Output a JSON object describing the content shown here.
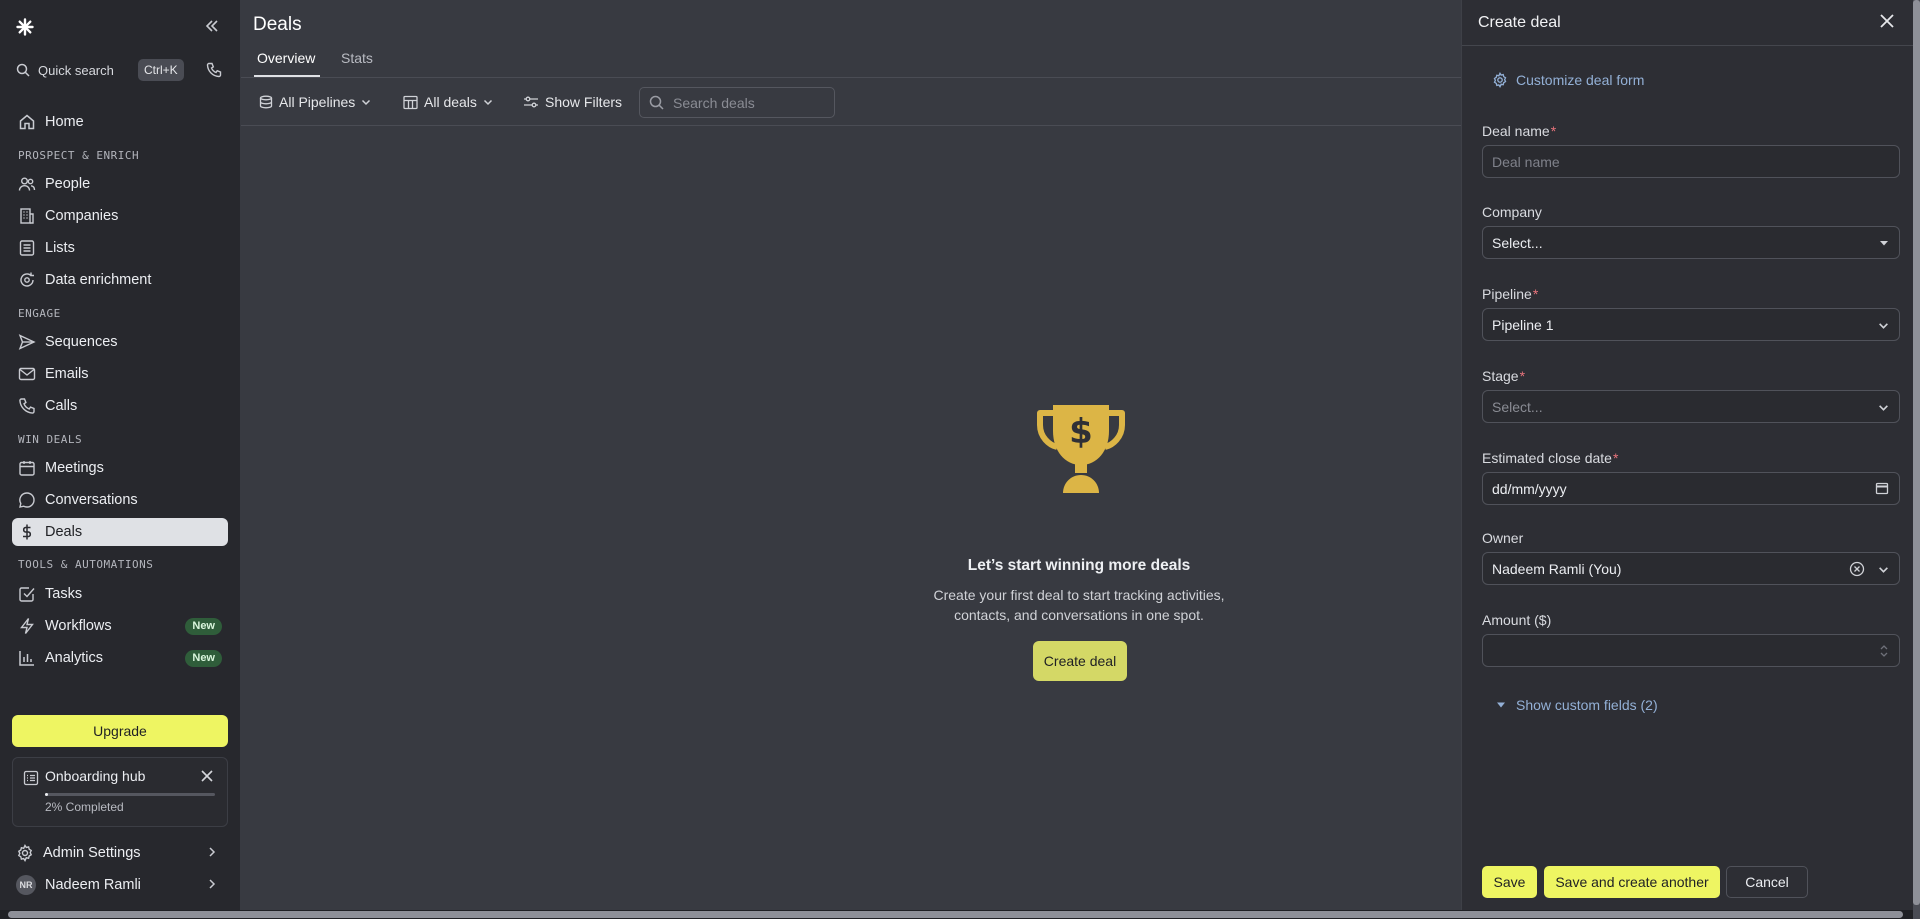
{
  "sidebar": {
    "quick_search": "Quick search",
    "shortcut": "Ctrl+K",
    "home": "Home",
    "sections": [
      "PROSPECT & ENRICH",
      "ENGAGE",
      "WIN DEALS",
      "TOOLS & AUTOMATIONS"
    ],
    "items": [
      {
        "label": "People",
        "icon": "people-icon"
      },
      {
        "label": "Companies",
        "icon": "building-icon"
      },
      {
        "label": "Lists",
        "icon": "list-icon"
      },
      {
        "label": "Data enrichment",
        "icon": "enrich-icon"
      },
      {
        "label": "Sequences",
        "icon": "send-icon"
      },
      {
        "label": "Emails",
        "icon": "mail-icon"
      },
      {
        "label": "Calls",
        "icon": "phone-icon"
      },
      {
        "label": "Meetings",
        "icon": "calendar-icon"
      },
      {
        "label": "Conversations",
        "icon": "chat-icon"
      },
      {
        "label": "Deals",
        "icon": "dollar-icon",
        "active": true
      },
      {
        "label": "Tasks",
        "icon": "check-icon"
      },
      {
        "label": "Workflows",
        "icon": "bolt-icon",
        "badge": "New"
      },
      {
        "label": "Analytics",
        "icon": "chart-icon",
        "badge": "New"
      }
    ],
    "upgrade": "Upgrade",
    "onboarding": {
      "title": "Onboarding hub",
      "progress_text": "2% Completed",
      "progress": 0.02
    },
    "admin_settings": "Admin Settings",
    "user": {
      "initials": "NR",
      "name": "Nadeem Ramli"
    }
  },
  "main": {
    "title": "Deals",
    "tabs": [
      {
        "label": "Overview",
        "active": true
      },
      {
        "label": "Stats",
        "active": false
      }
    ],
    "toolbar": {
      "pipelines": "All Pipelines",
      "deals": "All deals",
      "filters": "Show Filters",
      "search_placeholder": "Search deals"
    },
    "empty": {
      "title": "Let’s start winning more deals",
      "description": "Create your first deal to start tracking activities, contacts, and conversations in one spot.",
      "button": "Create deal"
    }
  },
  "drawer": {
    "title": "Create deal",
    "customize": "Customize deal form",
    "fields": {
      "deal_name": {
        "label": "Deal name",
        "placeholder": "Deal name",
        "required": "*"
      },
      "company": {
        "label": "Company",
        "value": "Select..."
      },
      "pipeline": {
        "label": "Pipeline",
        "value": "Pipeline 1",
        "required": "*"
      },
      "stage": {
        "label": "Stage",
        "value": "Select...",
        "required": "*"
      },
      "close_date": {
        "label": "Estimated close date",
        "value": "dd/mm/yyyy",
        "required": "*"
      },
      "owner": {
        "label": "Owner",
        "value": "Nadeem Ramli (You)"
      },
      "amount": {
        "label": "Amount ($)",
        "value": ""
      }
    },
    "show_custom": "Show custom fields (2)",
    "buttons": {
      "save": "Save",
      "save_another": "Save and create another",
      "cancel": "Cancel"
    }
  },
  "colors": {
    "accent": "#eef562",
    "link": "#93b0d6",
    "background": "#383a41",
    "sidebar": "#27282d"
  }
}
